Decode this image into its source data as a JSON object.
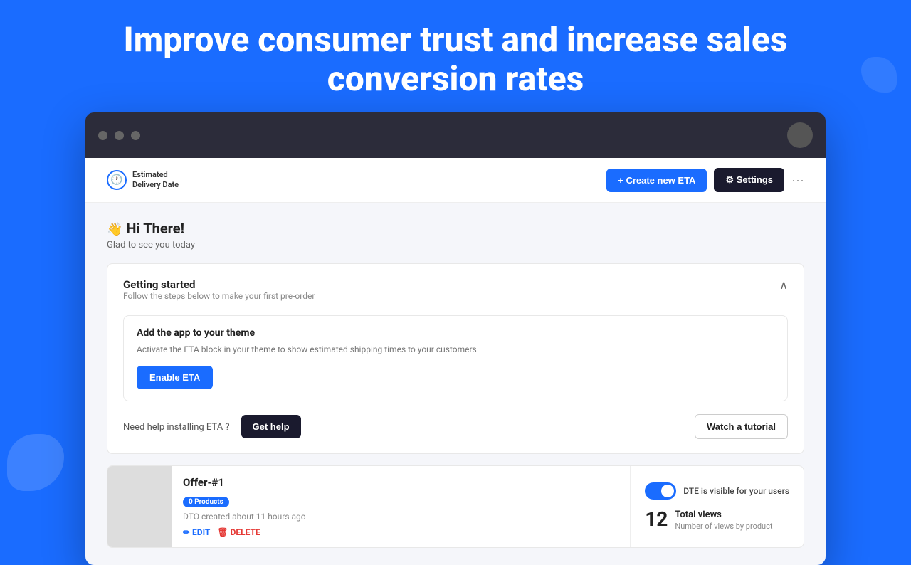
{
  "hero": {
    "title": "Improve consumer trust and increase sales conversion rates"
  },
  "browser": {
    "dots": [
      "dot1",
      "dot2",
      "dot3"
    ]
  },
  "header": {
    "logo_line1": "Estimated",
    "logo_line2": "Delivery Date",
    "create_btn": "+ Create new ETA",
    "settings_btn": "⚙ Settings",
    "dots_label": "···"
  },
  "greeting": {
    "emoji": "👋",
    "title": "Hi There!",
    "subtitle": "Glad to see you today"
  },
  "getting_started": {
    "title": "Getting started",
    "subtitle": "Follow the steps below to make your first pre-order",
    "step": {
      "title": "Add the app to your theme",
      "description": "Activate the ETA block in your theme to show estimated shipping times to your customers",
      "enable_btn": "Enable ETA"
    },
    "help_text": "Need help installing ETA ?",
    "get_help_btn": "Get help",
    "watch_btn": "Watch a tutorial"
  },
  "offer": {
    "name": "Offer-#1",
    "badge": "0 Products",
    "created_time": "DTO created about 11 hours ago",
    "edit_label": "EDIT",
    "delete_label": "DELETE",
    "toggle_label": "DTE is visible for your users",
    "views_number": "12",
    "views_title": "Total views",
    "views_subtitle": "Number of views by product"
  }
}
